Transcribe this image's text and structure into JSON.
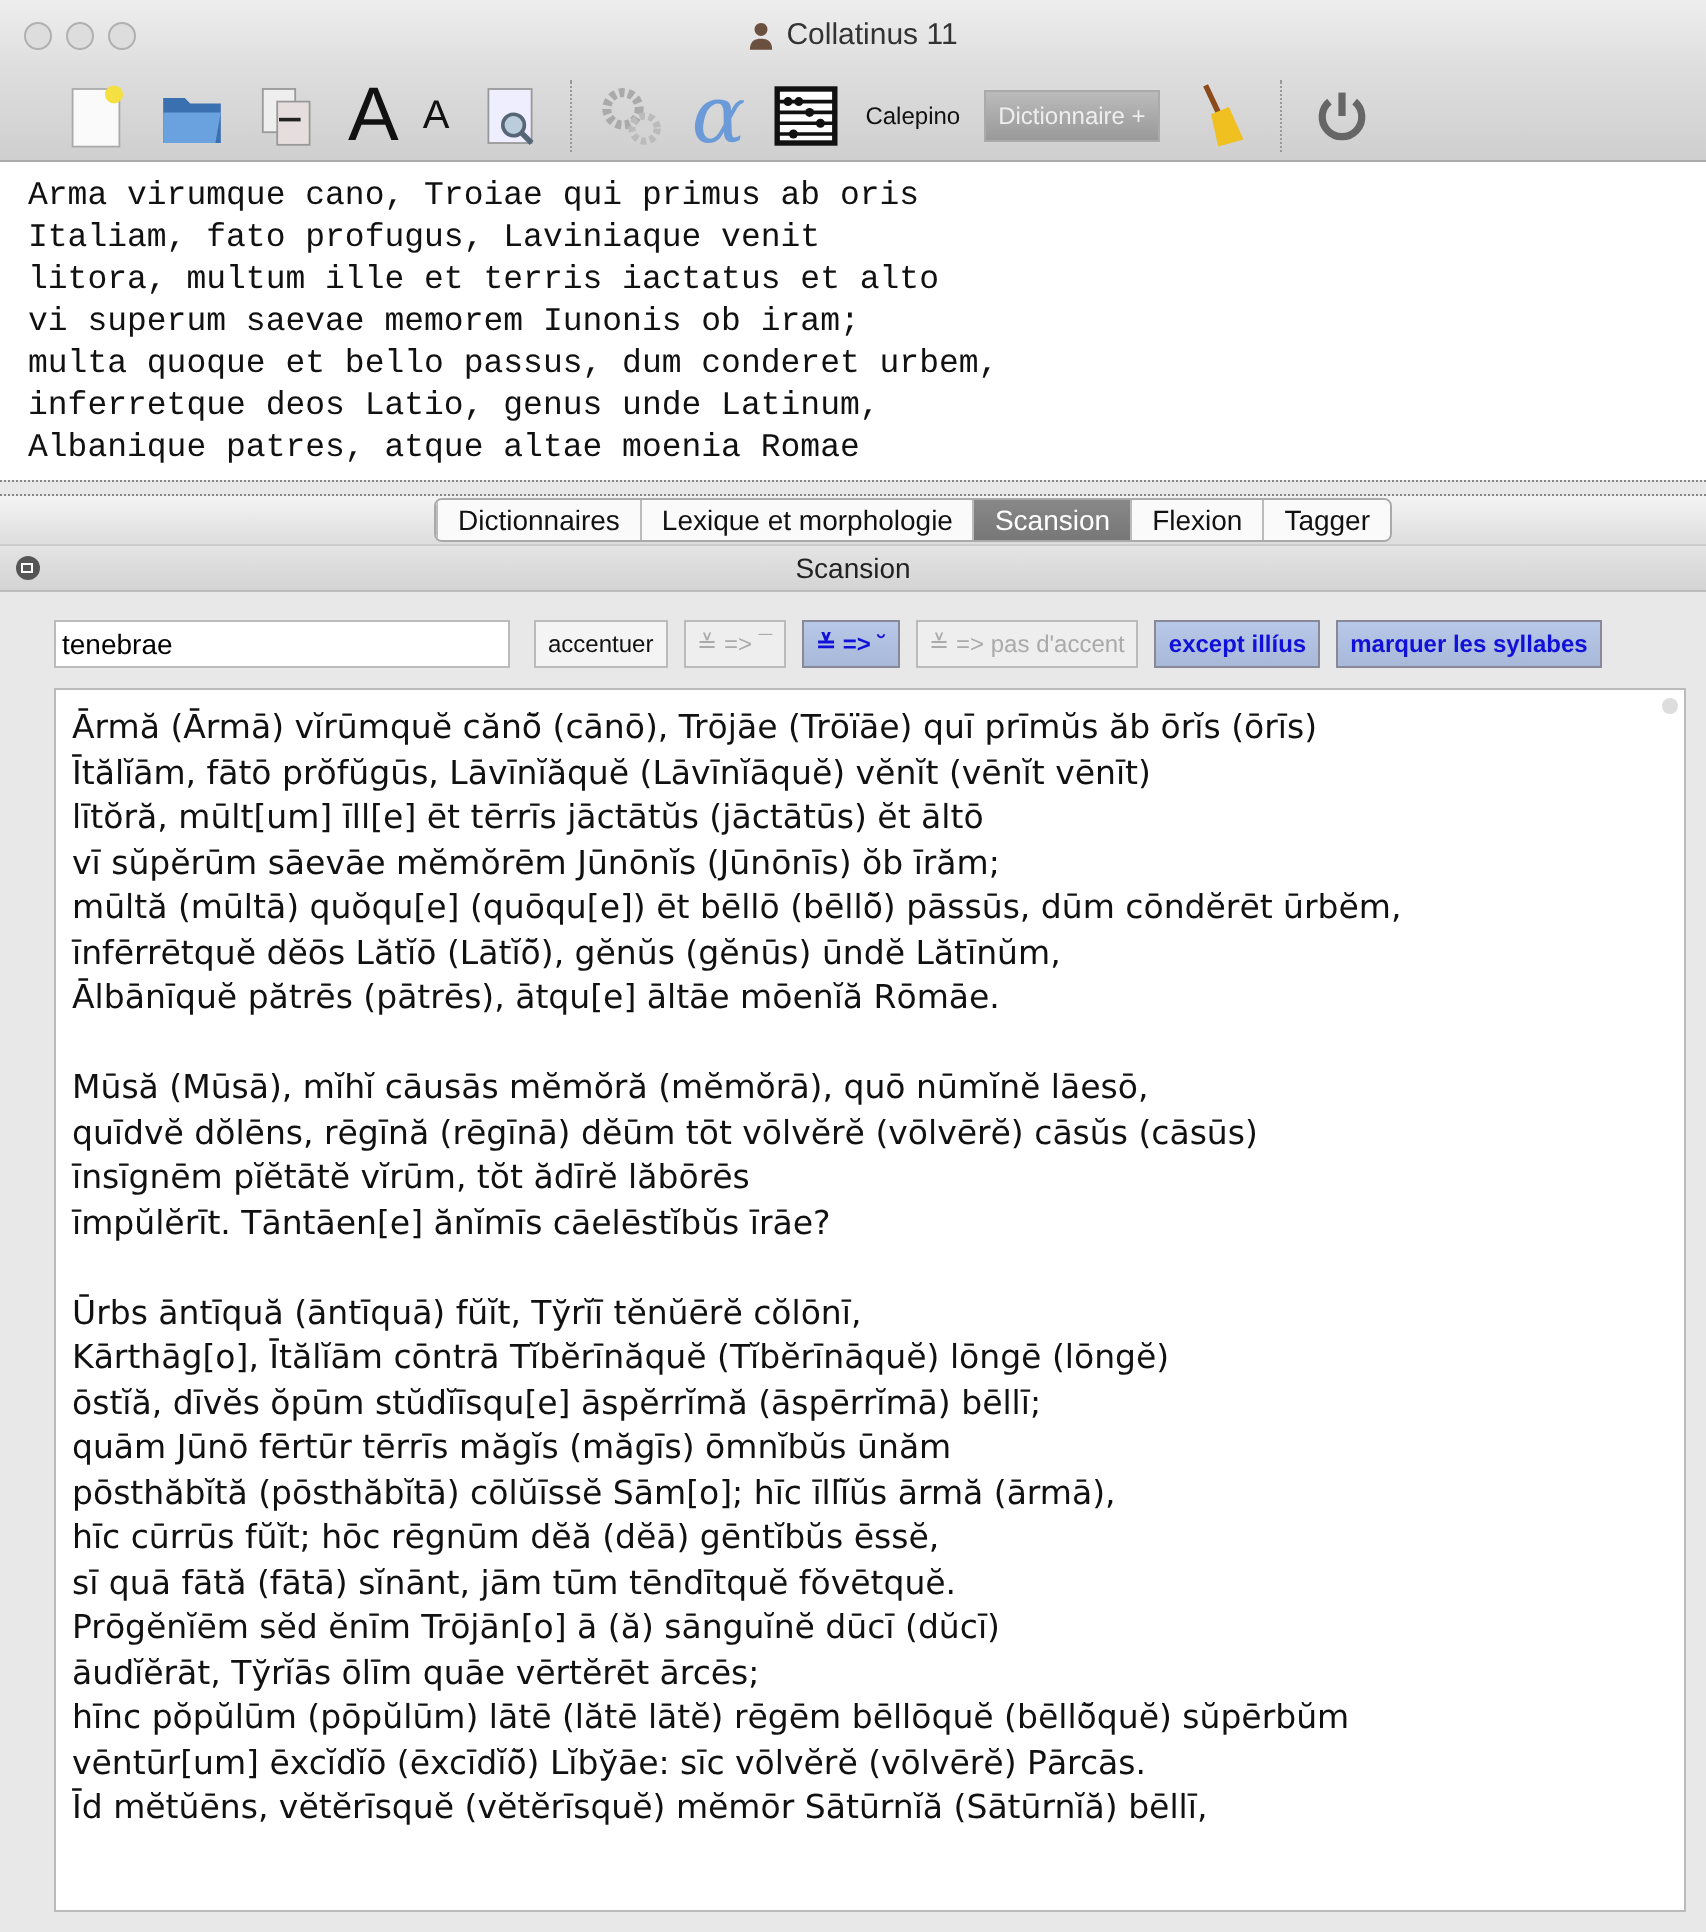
{
  "window": {
    "title": "Collatinus 11"
  },
  "toolbar": [
    {
      "kind": "new-doc"
    },
    {
      "kind": "folder"
    },
    {
      "kind": "copy"
    },
    {
      "kind": "big-a",
      "label": "A"
    },
    {
      "kind": "small-a",
      "label": "A"
    },
    {
      "kind": "doc-search"
    },
    {
      "kind": "sep"
    },
    {
      "kind": "gears"
    },
    {
      "kind": "alpha",
      "label": "α"
    },
    {
      "kind": "abacus"
    },
    {
      "kind": "text",
      "label": "Calepino"
    },
    {
      "kind": "pill",
      "label": "Dictionnaire +",
      "disabled": true
    },
    {
      "kind": "broom"
    },
    {
      "kind": "sep"
    },
    {
      "kind": "power"
    }
  ],
  "editor": {
    "lines": [
      "Arma virumque cano, Troiae qui primus ab oris",
      "Italiam, fato profugus, Laviniaque venit",
      "litora, multum ille et terris iactatus et alto",
      "vi superum saevae memorem Iunonis ob iram;",
      "multa quoque et bello passus, dum conderet urbem,",
      "inferretque deos Latio, genus unde Latinum,",
      "Albanique patres, atque altae moenia Romae"
    ]
  },
  "tabs": [
    {
      "label": "Dictionnaires",
      "selected": false
    },
    {
      "label": "Lexique et morphologie",
      "selected": false
    },
    {
      "label": "Scansion",
      "selected": true
    },
    {
      "label": "Flexion",
      "selected": false
    },
    {
      "label": "Tagger",
      "selected": false
    }
  ],
  "panel": {
    "title": "Scansion",
    "search": {
      "value": "tenebrae"
    },
    "controls": [
      {
        "label": "accentuer",
        "disabled": false,
        "selected": false
      },
      {
        "label": "≚ => ¯",
        "disabled": true,
        "selected": false
      },
      {
        "label": "≚ => ˘",
        "disabled": false,
        "selected": true
      },
      {
        "label": "≚ => pas d'accent",
        "disabled": true,
        "selected": false
      },
      {
        "label": "except illíus",
        "disabled": false,
        "selected": true
      },
      {
        "label": "marquer les syllabes",
        "disabled": false,
        "selected": true
      }
    ],
    "stanzas": [
      [
        "Ārmă (Ārmā) vĭrūmquĕ cănō̆ (cānō), Trōjāe (Trōïāe) quī prīmŭs ăb ōrĭs (ōrīs)",
        "Ītălĭām, fātō prŏfŭgūs, Lāvīnĭăquĕ (Lāvīnĭāquĕ) vĕnĭt (vēnĭt vēnīt)",
        "lītŏră, mūlt[um] īll[e] ēt tērrīs jāctātŭs (jāctātūs) ĕt āltō",
        "vī sŭpĕrūm sāevāe mĕmŏrēm Jūnōnĭs (Jūnōnīs) ŏb īrăm;",
        "mūltă (mūltā) quŏqu[e] (quōqu[e]) ēt bēllō (bēllō̆) pāssūs, dūm cōndĕrēt ūrbĕm,",
        "īnfērrētquĕ dĕōs Lătĭō (Lātĭō̆), gĕnŭs (gĕnūs) ūndĕ Lătīnŭm,",
        "Ālbānīquĕ pătrēs (pātrēs), ātqu[e] āltāe mōenĭă Rōmāe."
      ],
      [
        "Mūsă (Mūsā), mĭhĭ cāusās mĕmŏră (mĕmŏrā), quō nūmĭnĕ lāesō,",
        "quīdvĕ dŏlēns, rēgīnă (rēgīnā) dĕūm tōt vōlvĕrĕ (vōlvērĕ) cāsŭs (cāsūs)",
        "īnsīgnēm pĭĕtātĕ vĭrūm, tŏt ădīrĕ lăbōrēs",
        "īmpŭlĕrīt. Tāntāen[e] ănĭmīs cāelēstĭbŭs īrāe?"
      ],
      [
        "Ūrbs āntīquă (āntīquā) fŭĭt, Tўrĭī tĕnŭērĕ cŏlōnī,",
        "Kārthāg[o], Ītălĭām cōntrā Tĭbĕrīnăquĕ (Tĭbĕrīnāquĕ) lōngē (lōngĕ)",
        "ōstĭă, dīvĕs ŏpūm stŭdĭīsqu[e] āspĕrrĭmă (āspērrĭmā) bēllī;",
        "quām Jūnō fērtūr tērrīs măgĭs (măgīs) ōmnĭbŭs ūnăm",
        "pōsthăbĭtă (pōsthăbĭtā) cōlŭīssĕ Sām[o]; hīc īllĭ̄ŭs ārmă (ārmā),",
        "hīc cūrrūs fŭĭt; hōc rēgnūm dĕă (dĕā) gēntĭbŭs ēssĕ,",
        "sī quā fātă (fātā) sĭnānt, jām tūm tēndītquĕ fŏvētquĕ.",
        "Prōgĕnĭēm sĕd ĕnīm Trōjān[o] ā (ă) sānguĭnĕ dūcī (dŭcī)",
        "āudĭĕrāt, Tўrĭās ōlīm quāe vērtĕrēt ārcēs;",
        "hīnc pŏpŭlūm (pōpŭlūm) lātē (lătē lātĕ) rēgēm bēllōquĕ (bēllō̆quĕ) sŭpērbŭm",
        "vēntūr[um] ēxcĭdĭō (ēxcīdĭō̆) Lĭbўāe: sīc vōlvĕrĕ (vōlvērĕ) Pārcās.",
        "Īd mĕtŭēns, vĕtĕrīsquĕ (vĕtĕrīsquĕ) mĕmōr Sātūrnĭă (Sātūrnĭă) bēllī,"
      ]
    ]
  }
}
